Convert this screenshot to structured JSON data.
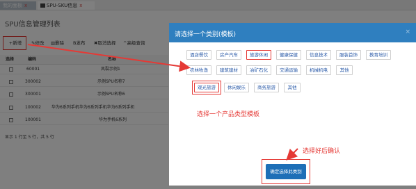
{
  "tabs": [
    {
      "label": "我的面板"
    },
    {
      "label": "SPU-SKU信息"
    }
  ],
  "page": {
    "title": "SPU信息管理列表"
  },
  "toolbar": {
    "add": "+新增",
    "edit": "修改",
    "delete": "删除",
    "publish": "发布",
    "cancel_select": "取消选择",
    "advanced_search": "高级查询"
  },
  "table": {
    "headers": [
      "选择",
      "编码",
      "名称"
    ],
    "rows": [
      {
        "code": "60001",
        "name": "风裂示例1"
      },
      {
        "code": "300002",
        "name": "示例SPU名称7"
      },
      {
        "code": "300001",
        "name": "示例SPU名称6"
      },
      {
        "code": "100002",
        "name": "华为6系列手机华为6系列手机华为6系列手机"
      },
      {
        "code": "100001",
        "name": "华为手机6系列"
      }
    ],
    "footer": "显示 1 行至 5 行，共 5 行"
  },
  "modal": {
    "title": "请选择一个类别(模板)",
    "close": "×",
    "categories_row1": [
      "酒店餐饮",
      "房产汽车",
      "旅游休闲",
      "健康保健",
      "信息技术",
      "服装首饰",
      "教育培训"
    ],
    "categories_row2": [
      "农林牧渔",
      "建筑建材",
      "冶矿石化",
      "交通运输",
      "机械机电",
      "其他"
    ],
    "categories_row3": [
      "观光旅游",
      "休闲娱乐",
      "商务旅游",
      "其他"
    ],
    "selected_category": "观光旅游",
    "confirm_button": "确定选择此类别"
  },
  "annotations": {
    "choose_template": "选择一个产品类型模板",
    "confirm_hint": "选择好后确认"
  },
  "colors": {
    "modal_header": "#2f7fbf",
    "highlight": "#e53935",
    "button": "#1e6fb7"
  }
}
